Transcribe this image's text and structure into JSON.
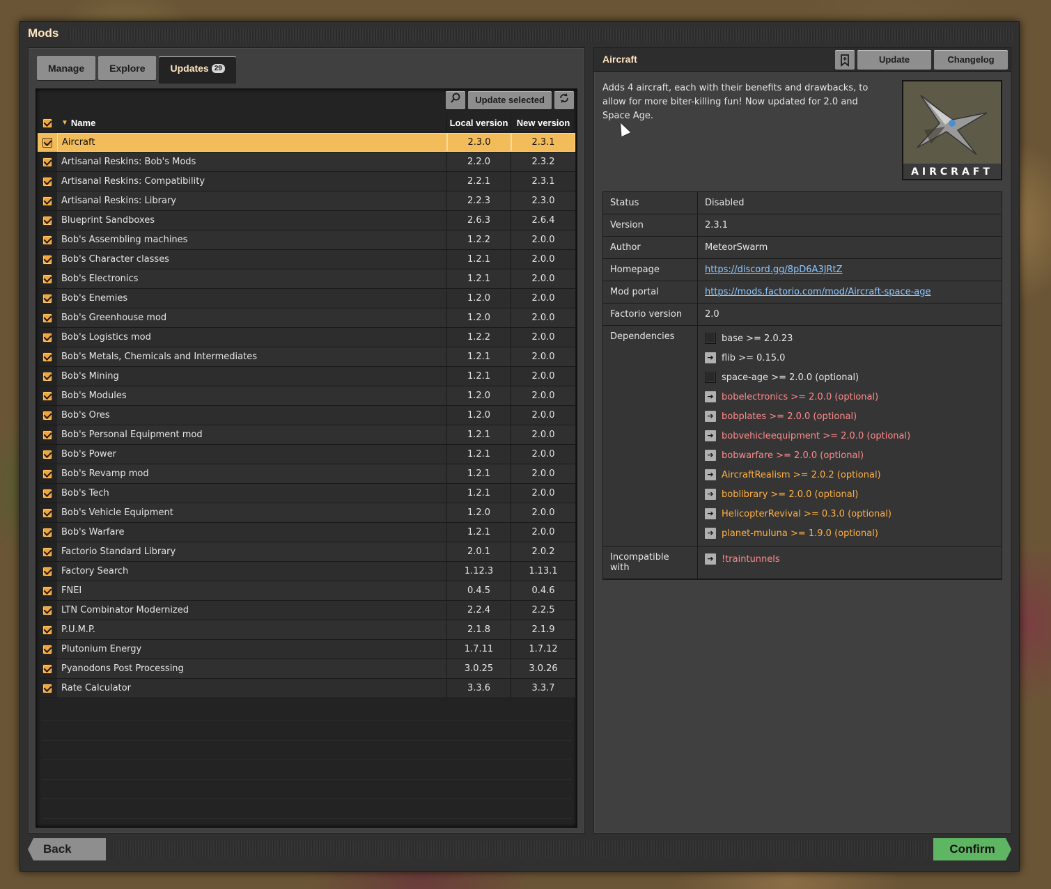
{
  "window": {
    "title": "Mods"
  },
  "tabs": [
    {
      "label": "Manage"
    },
    {
      "label": "Explore"
    },
    {
      "label": "Updates",
      "badge": "29"
    }
  ],
  "toolbar": {
    "search_icon": "search-icon",
    "update_selected": "Update selected",
    "refresh_icon": "refresh-icon"
  },
  "table": {
    "headers": {
      "name": "Name",
      "local": "Local version",
      "new": "New version"
    },
    "rows": [
      {
        "name": "Aircraft",
        "local": "2.3.0",
        "new": "2.3.1"
      },
      {
        "name": "Artisanal Reskins: Bob's Mods",
        "local": "2.2.0",
        "new": "2.3.2"
      },
      {
        "name": "Artisanal Reskins: Compatibility",
        "local": "2.2.1",
        "new": "2.3.1"
      },
      {
        "name": "Artisanal Reskins: Library",
        "local": "2.2.3",
        "new": "2.3.0"
      },
      {
        "name": "Blueprint Sandboxes",
        "local": "2.6.3",
        "new": "2.6.4"
      },
      {
        "name": "Bob's Assembling machines",
        "local": "1.2.2",
        "new": "2.0.0"
      },
      {
        "name": "Bob's Character classes",
        "local": "1.2.1",
        "new": "2.0.0"
      },
      {
        "name": "Bob's Electronics",
        "local": "1.2.1",
        "new": "2.0.0"
      },
      {
        "name": "Bob's Enemies",
        "local": "1.2.0",
        "new": "2.0.0"
      },
      {
        "name": "Bob's Greenhouse mod",
        "local": "1.2.0",
        "new": "2.0.0"
      },
      {
        "name": "Bob's Logistics mod",
        "local": "1.2.2",
        "new": "2.0.0"
      },
      {
        "name": "Bob's Metals, Chemicals and Intermediates",
        "local": "1.2.1",
        "new": "2.0.0"
      },
      {
        "name": "Bob's Mining",
        "local": "1.2.1",
        "new": "2.0.0"
      },
      {
        "name": "Bob's Modules",
        "local": "1.2.0",
        "new": "2.0.0"
      },
      {
        "name": "Bob's Ores",
        "local": "1.2.0",
        "new": "2.0.0"
      },
      {
        "name": "Bob's Personal Equipment mod",
        "local": "1.2.1",
        "new": "2.0.0"
      },
      {
        "name": "Bob's Power",
        "local": "1.2.1",
        "new": "2.0.0"
      },
      {
        "name": "Bob's Revamp mod",
        "local": "1.2.1",
        "new": "2.0.0"
      },
      {
        "name": "Bob's Tech",
        "local": "1.2.1",
        "new": "2.0.0"
      },
      {
        "name": "Bob's Vehicle Equipment",
        "local": "1.2.0",
        "new": "2.0.0"
      },
      {
        "name": "Bob's Warfare",
        "local": "1.2.1",
        "new": "2.0.0"
      },
      {
        "name": "Factorio Standard Library",
        "local": "2.0.1",
        "new": "2.0.2"
      },
      {
        "name": "Factory Search",
        "local": "1.12.3",
        "new": "1.13.1"
      },
      {
        "name": "FNEI",
        "local": "0.4.5",
        "new": "0.4.6"
      },
      {
        "name": "LTN Combinator Modernized",
        "local": "2.2.4",
        "new": "2.2.5"
      },
      {
        "name": "P.U.M.P.",
        "local": "2.1.8",
        "new": "2.1.9"
      },
      {
        "name": "Plutonium Energy",
        "local": "1.7.11",
        "new": "1.7.12"
      },
      {
        "name": "Pyanodons Post Processing",
        "local": "3.0.25",
        "new": "3.0.26"
      },
      {
        "name": "Rate Calculator",
        "local": "3.3.6",
        "new": "3.3.7"
      }
    ]
  },
  "detail": {
    "title": "Aircraft",
    "buttons": {
      "update": "Update",
      "changelog": "Changelog"
    },
    "description": "Adds 4 aircraft, each with their benefits and drawbacks, to allow for more biter-killing fun! Now updated for 2.0 and Space Age.",
    "thumbnail_label": "AIRCRAFT",
    "info": {
      "status_key": "Status",
      "status": "Disabled",
      "version_key": "Version",
      "version": "2.3.1",
      "author_key": "Author",
      "author": "MeteorSwarm",
      "homepage_key": "Homepage",
      "homepage": "https://discord.gg/8pD6A3JRtZ",
      "portal_key": "Mod portal",
      "portal": "https://mods.factorio.com/mod/Aircraft-space-age",
      "factorio_key": "Factorio version",
      "factorio": "2.0",
      "dependencies_key": "Dependencies",
      "incompatible_key": "Incompatible with"
    },
    "dependencies": [
      {
        "text": "base >= 2.0.23",
        "style": "normal",
        "icon": "box"
      },
      {
        "text": "flib >= 0.15.0",
        "style": "normal",
        "icon": "arrow"
      },
      {
        "text": "space-age >= 2.0.0 (optional)",
        "style": "normal",
        "icon": "box"
      },
      {
        "text": "bobelectronics >= 2.0.0 (optional)",
        "style": "red",
        "icon": "arrow"
      },
      {
        "text": "bobplates >= 2.0.0 (optional)",
        "style": "red",
        "icon": "arrow"
      },
      {
        "text": "bobvehicleequipment >= 2.0.0 (optional)",
        "style": "red",
        "icon": "arrow"
      },
      {
        "text": "bobwarfare >= 2.0.0 (optional)",
        "style": "red",
        "icon": "arrow"
      },
      {
        "text": "AircraftRealism >= 2.0.2 (optional)",
        "style": "orange",
        "icon": "arrow"
      },
      {
        "text": "boblibrary >= 2.0.0 (optional)",
        "style": "orange",
        "icon": "arrow"
      },
      {
        "text": "HelicopterRevival >= 0.3.0 (optional)",
        "style": "orange",
        "icon": "arrow"
      },
      {
        "text": "planet-muluna >= 1.9.0 (optional)",
        "style": "orange",
        "icon": "arrow"
      }
    ],
    "incompatible": [
      {
        "text": "!traintunnels",
        "style": "red",
        "icon": "arrow"
      }
    ]
  },
  "footer": {
    "back": "Back",
    "confirm": "Confirm"
  }
}
